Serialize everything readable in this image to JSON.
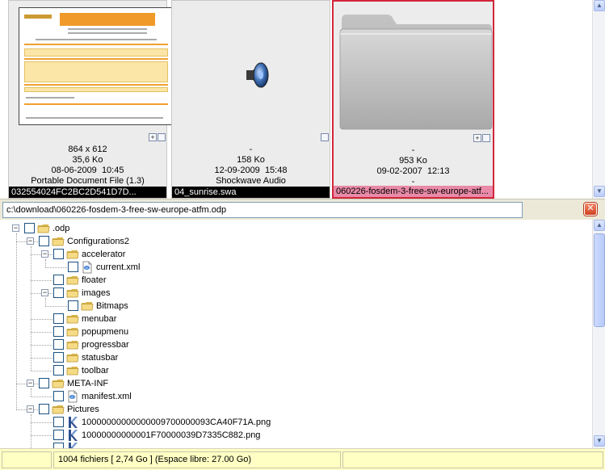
{
  "thumbnails": [
    {
      "dimensions": "864 x 612",
      "size": "35,6 Ko",
      "date": "08-06-2009",
      "time": "10:45",
      "type": "Portable Document File (1.3)",
      "name": "032554024FC2BC2D541D7D...",
      "selected": false,
      "buttons": [
        "+",
        ""
      ]
    },
    {
      "dimensions": "-",
      "size": "158 Ko",
      "date": "12-09-2009",
      "time": "15:48",
      "type": "Shockwave Audio",
      "name": "04_sunrise.swa",
      "selected": false,
      "buttons": [
        ""
      ]
    },
    {
      "dimensions": "-",
      "size": "953 Ko",
      "date": "09-02-2007",
      "time": "12:13",
      "type": "-",
      "name": "060226-fosdem-3-free-sw-europe-atf...",
      "selected": true,
      "buttons": [
        "+",
        ""
      ]
    }
  ],
  "path_bar": {
    "value": "c:\\download\\060226-fosdem-3-free-sw-europe-atfm.odp",
    "close_label": "✕"
  },
  "tree": [
    {
      "level": 0,
      "label": ".odp",
      "icon": "folder-icon",
      "expanded": true
    },
    {
      "level": 1,
      "label": "Configurations2",
      "icon": "folder-icon",
      "expanded": true
    },
    {
      "level": 2,
      "label": "accelerator",
      "icon": "folder-icon",
      "expanded": true
    },
    {
      "level": 3,
      "label": "current.xml",
      "icon": "xml-file-icon"
    },
    {
      "level": 2,
      "label": "floater",
      "icon": "folder-icon"
    },
    {
      "level": 2,
      "label": "images",
      "icon": "folder-icon",
      "expanded": true
    },
    {
      "level": 3,
      "label": "Bitmaps",
      "icon": "folder-icon"
    },
    {
      "level": 2,
      "label": "menubar",
      "icon": "folder-icon"
    },
    {
      "level": 2,
      "label": "popupmenu",
      "icon": "folder-icon"
    },
    {
      "level": 2,
      "label": "progressbar",
      "icon": "folder-icon"
    },
    {
      "level": 2,
      "label": "statusbar",
      "icon": "folder-icon"
    },
    {
      "level": 2,
      "label": "toolbar",
      "icon": "folder-icon"
    },
    {
      "level": 1,
      "label": "META-INF",
      "icon": "folder-icon",
      "expanded": true
    },
    {
      "level": 2,
      "label": "manifest.xml",
      "icon": "xml-file-icon"
    },
    {
      "level": 1,
      "label": "Pictures",
      "icon": "folder-icon",
      "expanded": true
    },
    {
      "level": 2,
      "label": "10000000000000009700000093CA40F71A.png",
      "icon": "png-file-icon"
    },
    {
      "level": 2,
      "label": "10000000000001F70000039D7335C882.png",
      "icon": "png-file-icon"
    },
    {
      "level": 2,
      "label": "",
      "icon": "png-file-icon"
    }
  ],
  "status": {
    "left": "",
    "files": "1004 fichiers [ 2,74 Go ] (Espace libre: 27.00 Go)",
    "right": ""
  },
  "colors": {
    "selected_border": "#d2263a",
    "selected_name_bg": "#e88aa8",
    "name_bg": "#000000",
    "status_bg": "#ffffc4",
    "folder": "#f2d77e"
  }
}
